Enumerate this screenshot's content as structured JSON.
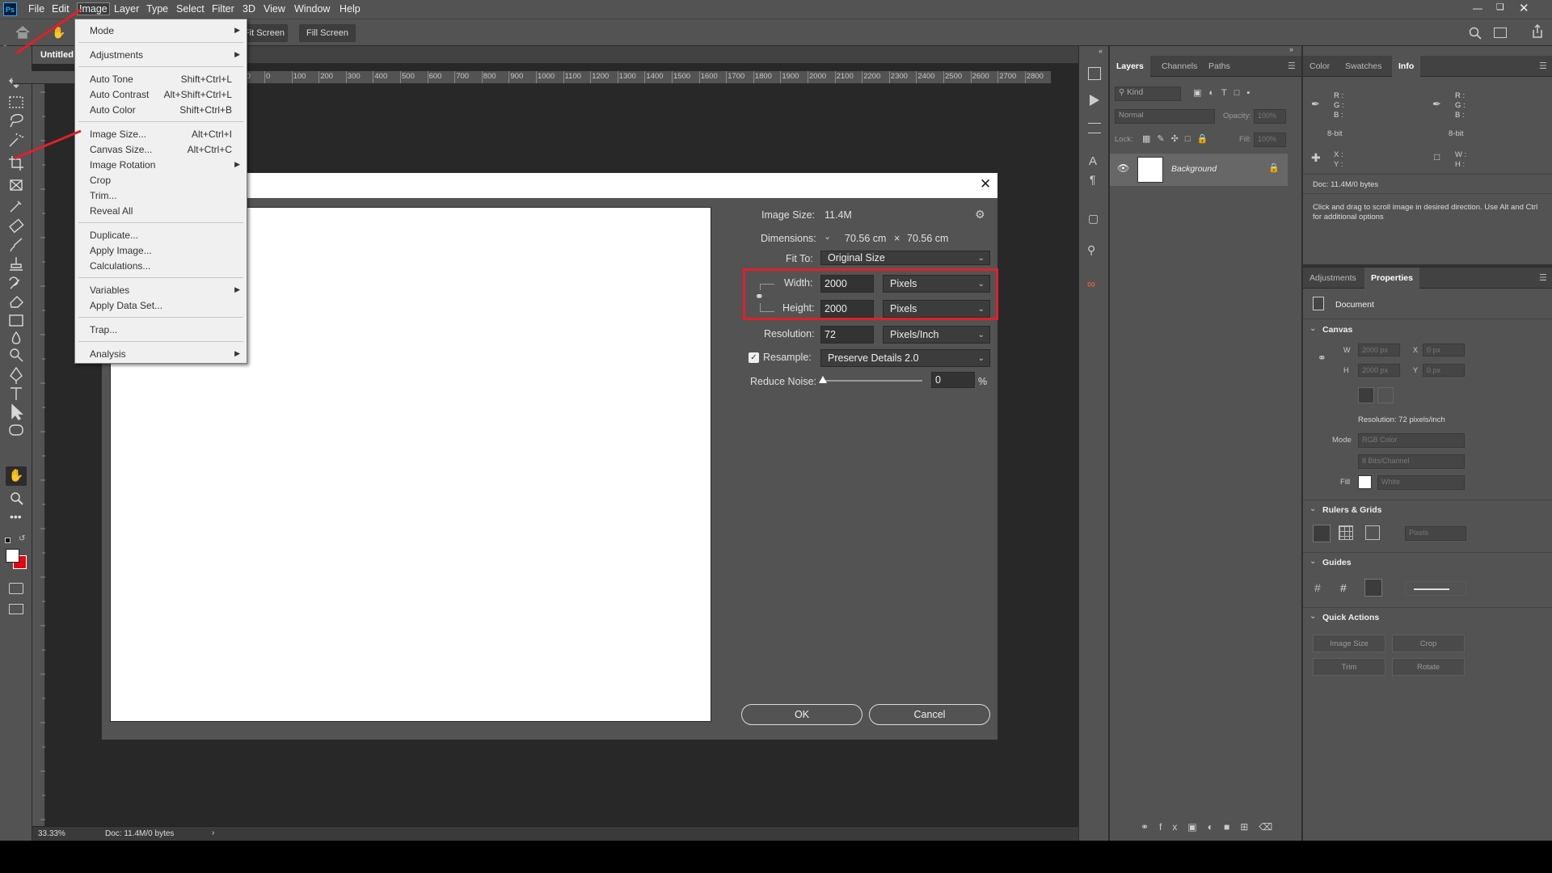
{
  "menubar": {
    "items": [
      "File",
      "Edit",
      "Image",
      "Layer",
      "Type",
      "Select",
      "Filter",
      "3D",
      "View",
      "Window",
      "Help"
    ],
    "active": "Image"
  },
  "options_bar": {
    "fit_screen": "Fit Screen",
    "fill_screen": "Fill Screen"
  },
  "document": {
    "tab_title": "Untitled",
    "zoom": "33.33%",
    "doc_info": "Doc: 11.4M/0 bytes"
  },
  "rulers": {
    "h_ticks": [
      "100",
      "0",
      "100",
      "200",
      "300",
      "400",
      "500",
      "600",
      "700",
      "800",
      "900",
      "1000",
      "1100",
      "1200",
      "1300",
      "1400",
      "1500",
      "1600",
      "1700",
      "1800",
      "1900",
      "2000",
      "2100",
      "2200",
      "2300",
      "2400",
      "2500",
      "2600",
      "2700",
      "2800"
    ]
  },
  "image_menu": {
    "groups": [
      [
        {
          "label": "Mode",
          "submenu": true
        }
      ],
      [
        {
          "label": "Adjustments",
          "submenu": true
        }
      ],
      [
        {
          "label": "Auto Tone",
          "shortcut": "Shift+Ctrl+L"
        },
        {
          "label": "Auto Contrast",
          "shortcut": "Alt+Shift+Ctrl+L"
        },
        {
          "label": "Auto Color",
          "shortcut": "Shift+Ctrl+B"
        }
      ],
      [
        {
          "label": "Image Size...",
          "shortcut": "Alt+Ctrl+I"
        },
        {
          "label": "Canvas Size...",
          "shortcut": "Alt+Ctrl+C"
        },
        {
          "label": "Image Rotation",
          "submenu": true
        },
        {
          "label": "Crop"
        },
        {
          "label": "Trim..."
        },
        {
          "label": "Reveal All"
        }
      ],
      [
        {
          "label": "Duplicate..."
        },
        {
          "label": "Apply Image..."
        },
        {
          "label": "Calculations..."
        }
      ],
      [
        {
          "label": "Variables",
          "submenu": true
        },
        {
          "label": "Apply Data Set..."
        }
      ],
      [
        {
          "label": "Trap..."
        }
      ],
      [
        {
          "label": "Analysis",
          "submenu": true
        }
      ]
    ]
  },
  "image_size_dialog": {
    "image_size_label": "Image Size:",
    "image_size_value": "11.4M",
    "dimensions_label": "Dimensions:",
    "dim_w": "70.56 cm",
    "dim_x": "×",
    "dim_h": "70.56 cm",
    "fit_to_label": "Fit To:",
    "fit_to_value": "Original Size",
    "width_label": "Width:",
    "width_value": "2000",
    "width_unit": "Pixels",
    "height_label": "Height:",
    "height_value": "2000",
    "height_unit": "Pixels",
    "resolution_label": "Resolution:",
    "resolution_value": "72",
    "resolution_unit": "Pixels/Inch",
    "resample_label": "Resample:",
    "resample_checked": true,
    "resample_value": "Preserve Details 2.0",
    "reduce_noise_label": "Reduce Noise:",
    "reduce_noise_value": "0",
    "reduce_noise_unit": "%",
    "ok": "OK",
    "cancel": "Cancel"
  },
  "layers_panel": {
    "tabs": [
      "Layers",
      "Channels",
      "Paths"
    ],
    "active_tab": "Layers",
    "kind_placeholder": "Kind",
    "blend_mode": "Normal",
    "opacity_label": "Opacity:",
    "opacity_value": "100%",
    "lock_label": "Lock:",
    "fill_label": "Fill:",
    "fill_value": "100%",
    "layers": [
      {
        "name": "Background",
        "visible": true,
        "locked": true
      }
    ]
  },
  "info_panel": {
    "tabs": [
      "Color",
      "Swatches",
      "Info"
    ],
    "active_tab": "Info",
    "r": "R :",
    "g": "G :",
    "b": "B :",
    "bit_left": "8-bit",
    "bit_right": "8-bit",
    "x": "X :",
    "y": "Y :",
    "w": "W :",
    "h": "H :",
    "doc": "Doc: 11.4M/0 bytes",
    "hint": "Click and drag to scroll image in desired direction.  Use Alt and Ctrl for additional options"
  },
  "properties_panel": {
    "tabs": [
      "Adjustments",
      "Properties"
    ],
    "active_tab": "Properties",
    "doc_label": "Document",
    "canvas_section": "Canvas",
    "w_label": "W",
    "w_value": "2000 px",
    "h_label": "H",
    "h_value": "2000 px",
    "x_label": "X",
    "x_value": "0 px",
    "y_label": "Y",
    "y_value": "0 px",
    "resolution": "Resolution: 72 pixels/inch",
    "mode_label": "Mode",
    "mode_value": "RGB Color",
    "bits_value": "8 Bits/Channel",
    "fill_label": "Fill",
    "fill_value": "White",
    "rulers_section": "Rulers & Grids",
    "rulers_unit": "Pixels",
    "guides_section": "Guides",
    "quick_actions_section": "Quick Actions",
    "qa_image_size": "Image Size",
    "qa_crop": "Crop",
    "qa_trim": "Trim",
    "qa_rotate": "Rotate"
  },
  "colors": {
    "highlight_red": "#e0202a",
    "foreground": "#ffffff",
    "background": "#e30613"
  }
}
